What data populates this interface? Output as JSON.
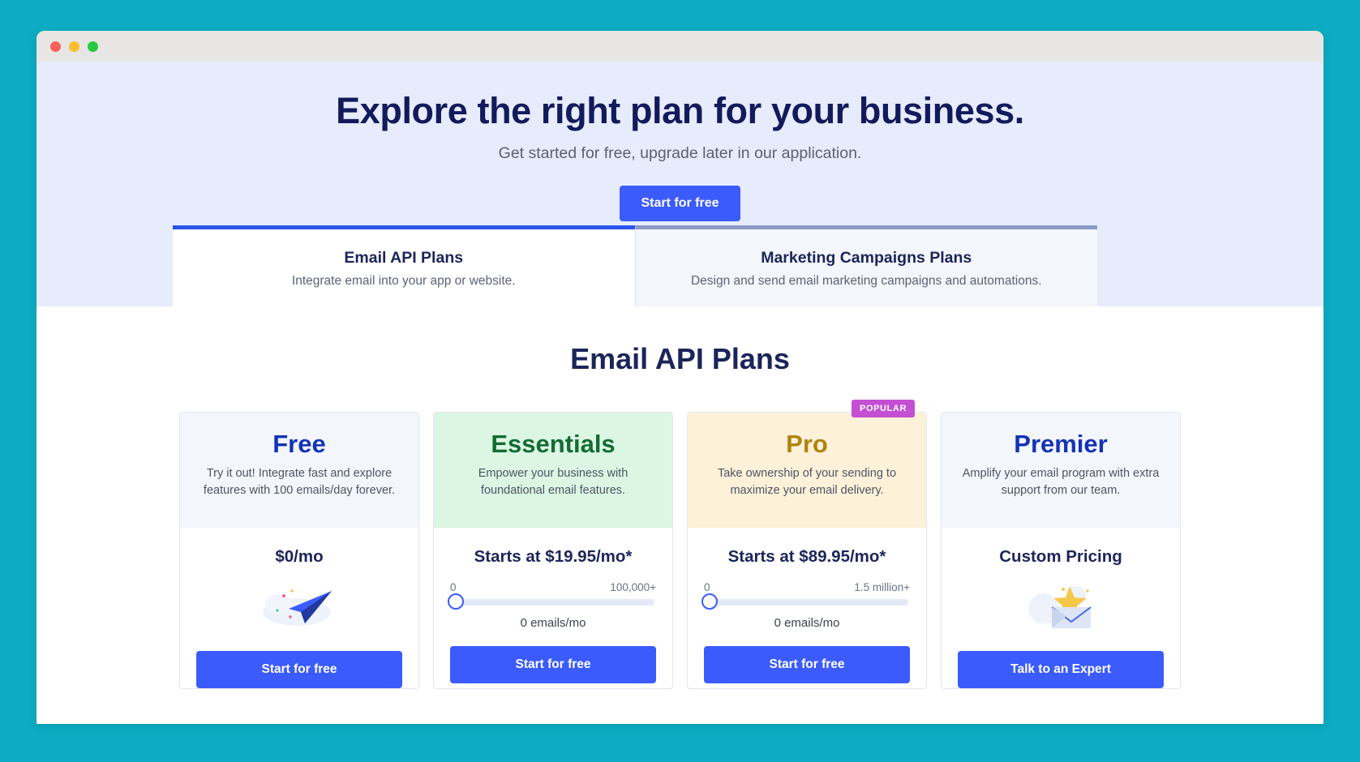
{
  "window": {
    "traffic_lights": [
      "close",
      "minimize",
      "maximize"
    ]
  },
  "hero": {
    "title": "Explore the right plan for your business.",
    "subtitle": "Get started for free, upgrade later in our application.",
    "cta_label": "Start for free"
  },
  "tabs": [
    {
      "label": "Email API Plans",
      "sublabel": "Integrate email into your app or website.",
      "active": true
    },
    {
      "label": "Marketing Campaigns Plans",
      "sublabel": "Design and send email marketing campaigns and automations.",
      "active": false
    }
  ],
  "section": {
    "title": "Email API Plans"
  },
  "cards": [
    {
      "name": "Free",
      "description": "Try it out! Integrate fast and explore features with 100 emails/day forever.",
      "price": "$0/mo",
      "cta_label": "Start for free",
      "badge": null,
      "head_bg": "#f3f6fc",
      "name_color": "#1433b5",
      "illustration": "paper-plane-cloud",
      "slider": null
    },
    {
      "name": "Essentials",
      "description": "Empower your business with foundational email features.",
      "price": "Starts at $19.95/mo*",
      "cta_label": "Start for free",
      "badge": null,
      "head_bg": "#dcf6e4",
      "name_color": "#136c32",
      "illustration": null,
      "slider": {
        "min_label": "0",
        "max_label": "100,000+",
        "value_label": "0 emails/mo",
        "fill_percent": 0
      }
    },
    {
      "name": "Pro",
      "description": "Take ownership of your sending to maximize your email delivery.",
      "price": "Starts at $89.95/mo*",
      "cta_label": "Start for free",
      "badge": "POPULAR",
      "head_bg": "#fdf2d9",
      "name_color": "#b1840e",
      "illustration": null,
      "slider": {
        "min_label": "0",
        "max_label": "1.5 million+",
        "value_label": "0 emails/mo",
        "fill_percent": 0
      }
    },
    {
      "name": "Premier",
      "description": "Amplify your email program with extra support from our team.",
      "price": "Custom Pricing",
      "cta_label": "Talk to an Expert",
      "badge": null,
      "head_bg": "#f3f6fd",
      "name_color": "#1433b5",
      "illustration": "envelope-star",
      "slider": null
    }
  ],
  "colors": {
    "page_background": "#0cadc4",
    "accent_blue": "#3b5bfd",
    "badge_magenta": "#c44fd4",
    "heading_navy": "#131a5c"
  }
}
